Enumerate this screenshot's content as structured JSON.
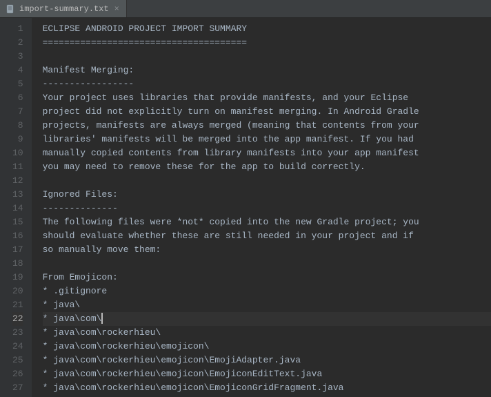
{
  "tab": {
    "filename": "import-summary.txt",
    "close_glyph": "×"
  },
  "editor": {
    "current_line": 22,
    "lines": [
      "ECLIPSE ANDROID PROJECT IMPORT SUMMARY",
      "======================================",
      "",
      "Manifest Merging:",
      "-----------------",
      "Your project uses libraries that provide manifests, and your Eclipse",
      "project did not explicitly turn on manifest merging. In Android Gradle",
      "projects, manifests are always merged (meaning that contents from your",
      "libraries' manifests will be merged into the app manifest. If you had",
      "manually copied contents from library manifests into your app manifest",
      "you may need to remove these for the app to build correctly.",
      "",
      "Ignored Files:",
      "--------------",
      "The following files were *not* copied into the new Gradle project; you",
      "should evaluate whether these are still needed in your project and if",
      "so manually move them:",
      "",
      "From Emojicon:",
      "* .gitignore",
      "* java\\",
      "* java\\com\\",
      "* java\\com\\rockerhieu\\",
      "* java\\com\\rockerhieu\\emojicon\\",
      "* java\\com\\rockerhieu\\emojicon\\EmojiAdapter.java",
      "* java\\com\\rockerhieu\\emojicon\\EmojiconEditText.java",
      "* java\\com\\rockerhieu\\emojicon\\EmojiconGridFragment.java"
    ]
  }
}
